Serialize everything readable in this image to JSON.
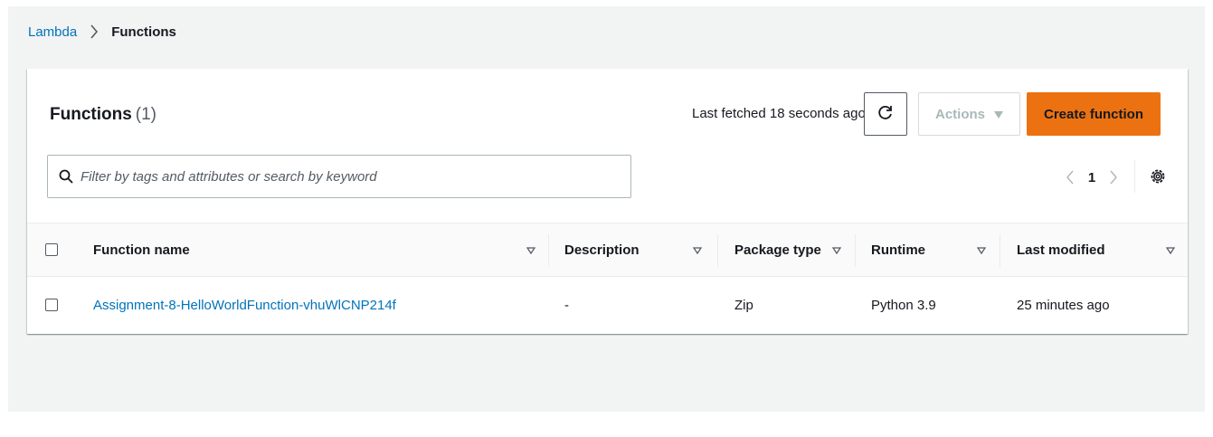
{
  "breadcrumb": {
    "root": "Lambda",
    "current": "Functions"
  },
  "panel": {
    "title": "Functions",
    "count": "(1)",
    "last_fetched": "Last fetched 18 seconds ago",
    "actions_label": "Actions",
    "create_label": "Create function"
  },
  "search": {
    "placeholder": "Filter by tags and attributes or search by keyword",
    "value": ""
  },
  "pagination": {
    "current_page": "1"
  },
  "table": {
    "columns": [
      "Function name",
      "Description",
      "Package type",
      "Runtime",
      "Last modified"
    ],
    "rows": [
      {
        "function_name": "Assignment-8-HelloWorldFunction-vhuWlCNP214f",
        "description": "-",
        "package_type": "Zip",
        "runtime": "Python 3.9",
        "last_modified": "25 minutes ago"
      }
    ]
  },
  "colors": {
    "link": "#0073bb",
    "primary_button": "#ec7211",
    "background": "#f2f3f3"
  },
  "icons": [
    "chevron-right-icon",
    "refresh-icon",
    "caret-down-icon",
    "search-icon",
    "chevron-left-icon",
    "settings-gear-icon",
    "sort-icon"
  ]
}
